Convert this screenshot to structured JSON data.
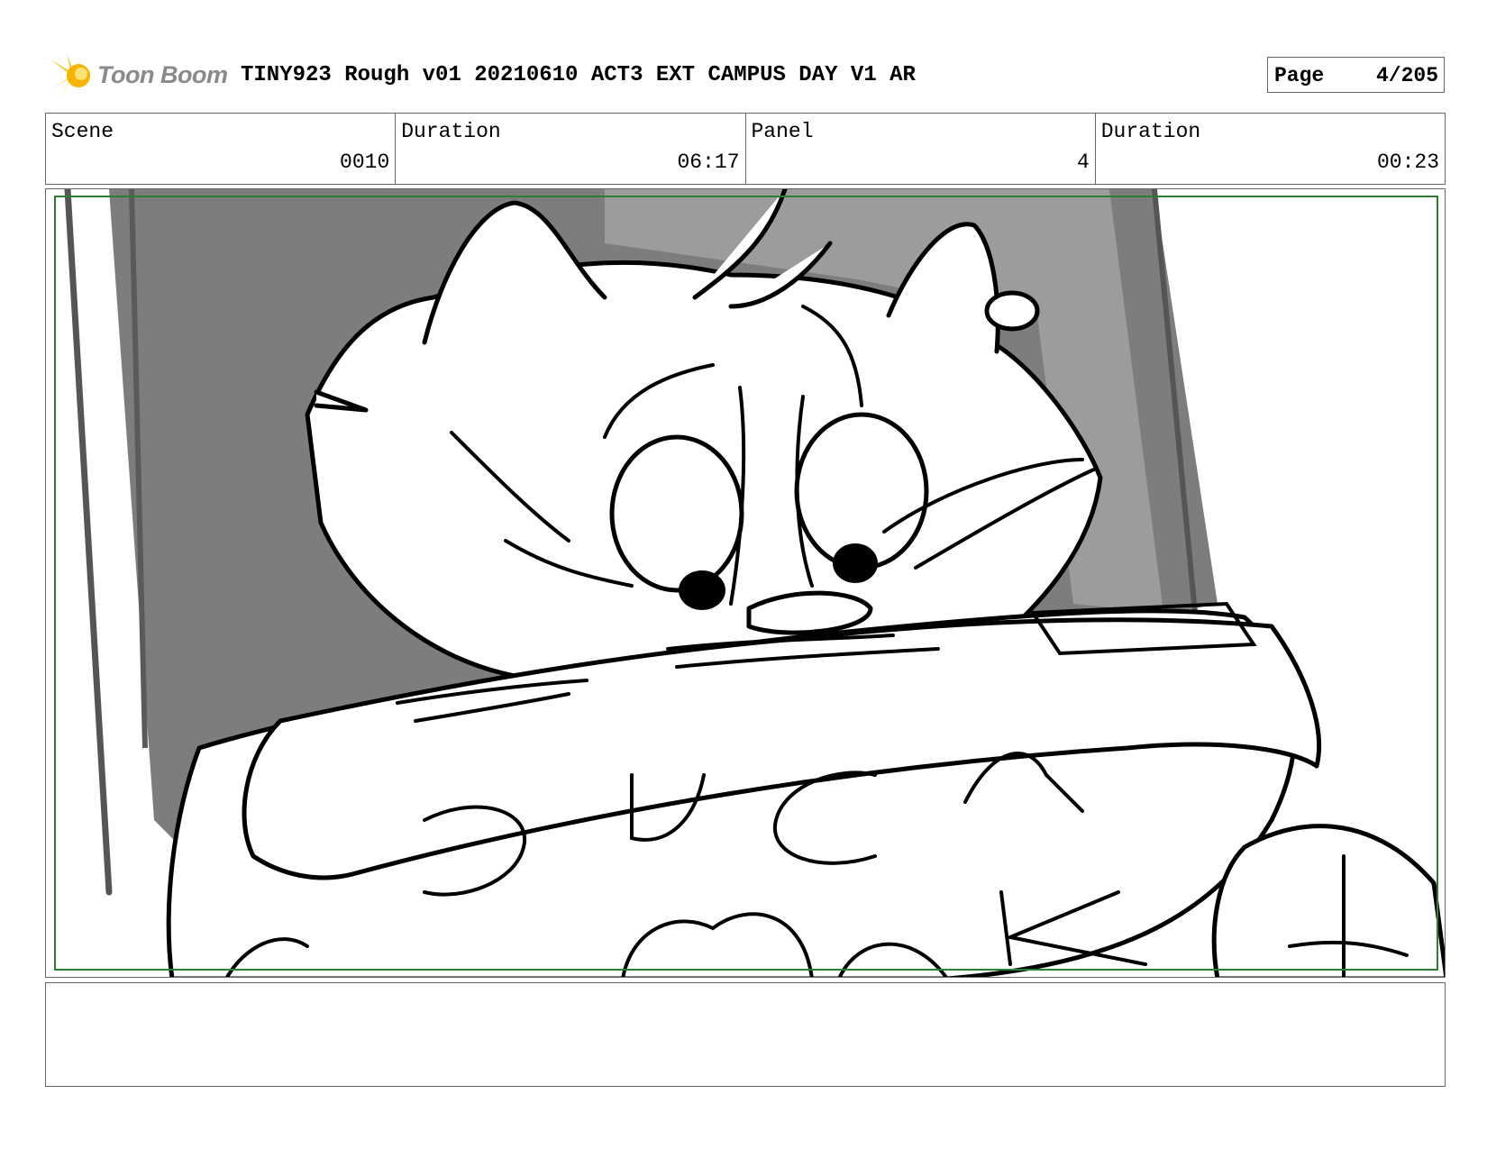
{
  "header": {
    "logo_text": "Toon Boom",
    "title": "TINY923 Rough v01 20210610 ACT3 EXT CAMPUS DAY V1 AR",
    "page_label": "Page",
    "page_value": "4/205"
  },
  "info": {
    "scene_label": "Scene",
    "scene_value": "0010",
    "scene_duration_label": "Duration",
    "scene_duration_value": "06:17",
    "panel_label": "Panel",
    "panel_value": "4",
    "panel_duration_label": "Duration",
    "panel_duration_value": "00:23"
  },
  "panel_image": {
    "description_icon": "storyboard-sketch",
    "safe_frame_color": "#2e7d32"
  },
  "notes": {
    "text": ""
  }
}
